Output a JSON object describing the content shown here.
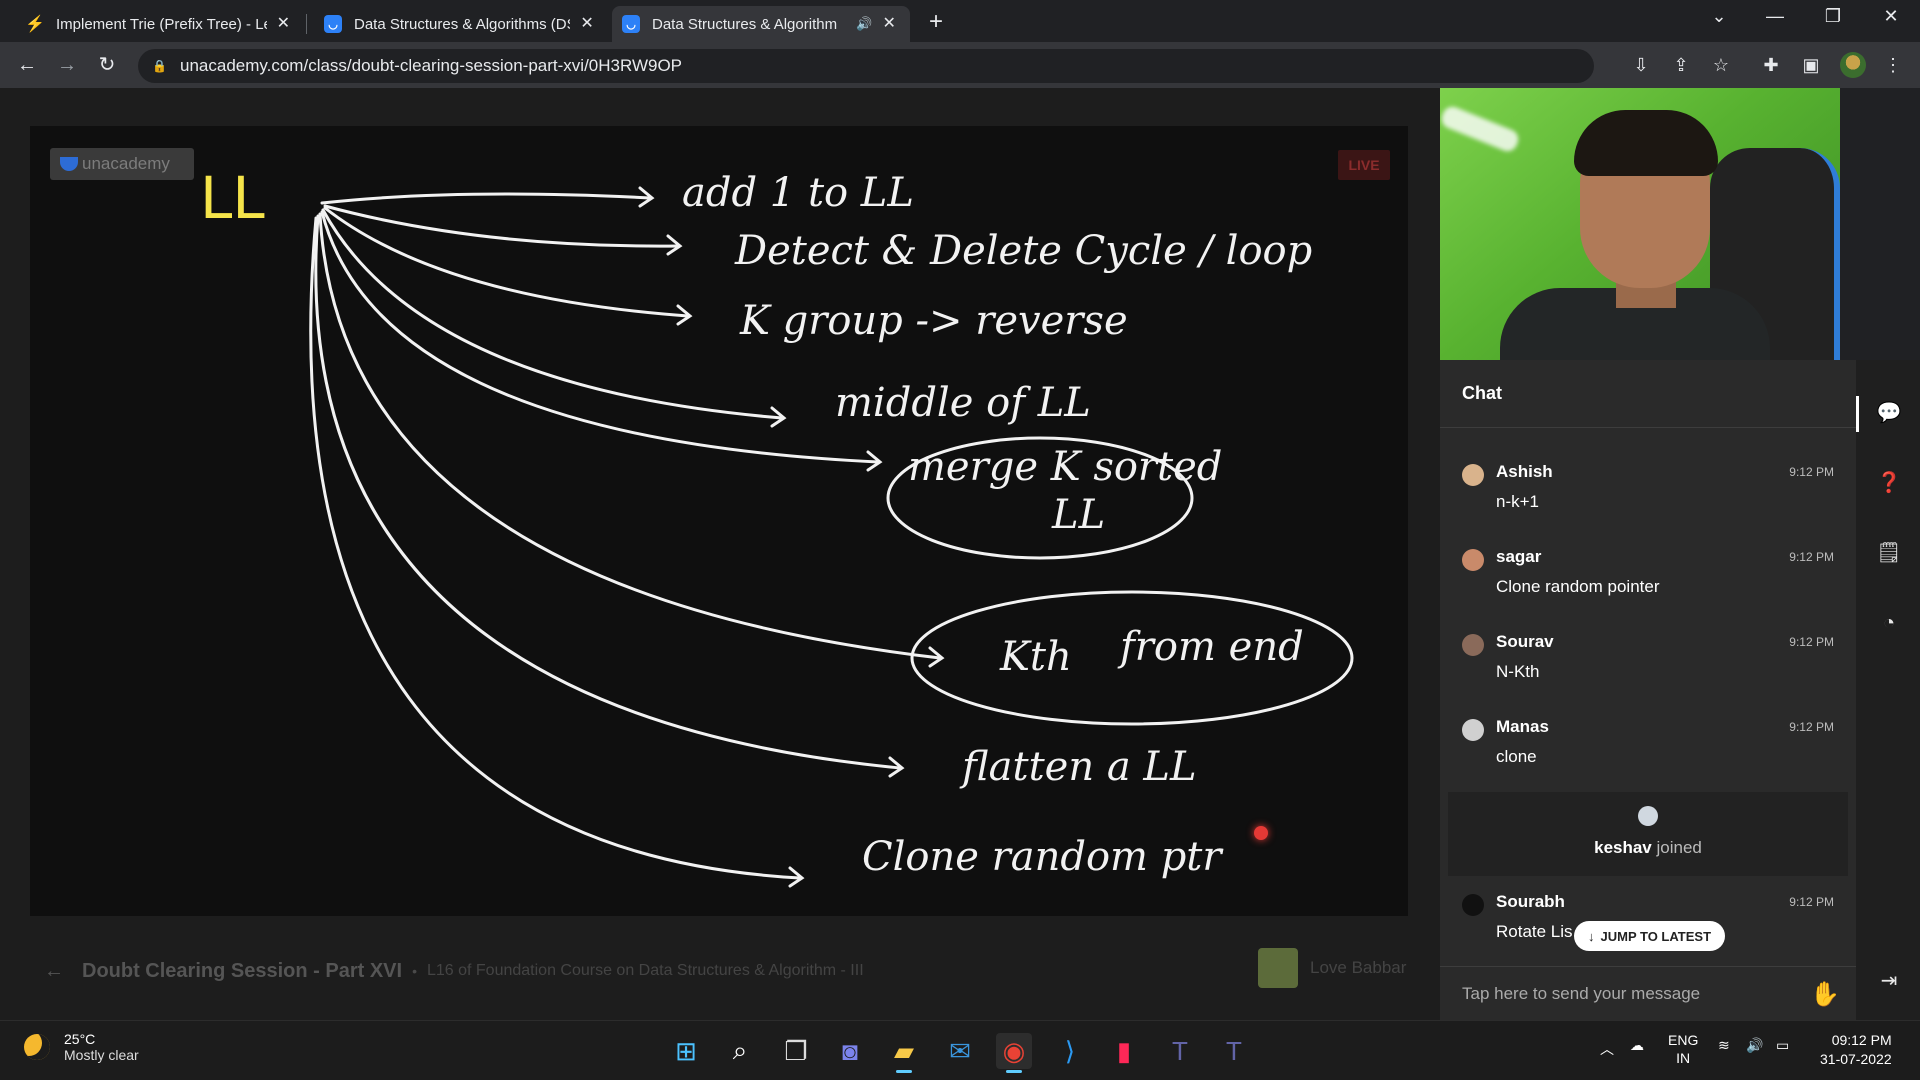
{
  "browser": {
    "tabs": [
      {
        "title": "Implement Trie (Prefix Tree) - Lee",
        "icon": "leetcode-icon"
      },
      {
        "title": "Data Structures & Algorithms (DS",
        "icon": "unacademy-icon"
      },
      {
        "title": "Data Structures & Algorithm",
        "icon": "unacademy-icon",
        "active": true
      }
    ],
    "url": "unacademy.com/class/doubt-clearing-session-part-xvi/0H3RW9OP"
  },
  "board": {
    "logo": "unacademy",
    "live_label": "LIVE",
    "heading": "LL",
    "notes": [
      "add 1 to LL",
      "Detect & Delete Cycle / loop",
      "K group -> reverse",
      "middle of LL",
      "merge K sorted",
      "LL",
      "Kth",
      "from end",
      "flatten a LL",
      "Clone random ptr"
    ]
  },
  "session": {
    "title": "Doubt Clearing Session - Part XVI",
    "subtitle": "L16 of Foundation Course on Data Structures & Algorithm - III",
    "educator": "Love Babbar"
  },
  "chat": {
    "header": "Chat",
    "messages": [
      {
        "user": "Ashish",
        "time": "9:12 PM",
        "text": "n-k+1",
        "avatar_color": "#d9b38c"
      },
      {
        "user": "sagar",
        "time": "9:12 PM",
        "text": "Clone random pointer",
        "avatar_color": "#c98a6a"
      },
      {
        "user": "Sourav",
        "time": "9:12 PM",
        "text": "N-Kth",
        "avatar_color": "#8a6a5a"
      },
      {
        "user": "Manas",
        "time": "9:12 PM",
        "text": "clone",
        "avatar_color": "#d0d0d0"
      }
    ],
    "joined_user": "keshav",
    "joined_text": "joined",
    "last_message": {
      "user": "Sourabh",
      "time": "9:12 PM",
      "text": "Rotate Lis",
      "avatar_color": "#111111"
    },
    "jump_label": "JUMP TO LATEST",
    "input_placeholder": "Tap here to send your message"
  },
  "taskbar": {
    "temperature": "25°C",
    "condition": "Mostly clear",
    "lang_top": "ENG",
    "lang_bottom": "IN",
    "time": "09:12 PM",
    "date": "31-07-2022"
  }
}
